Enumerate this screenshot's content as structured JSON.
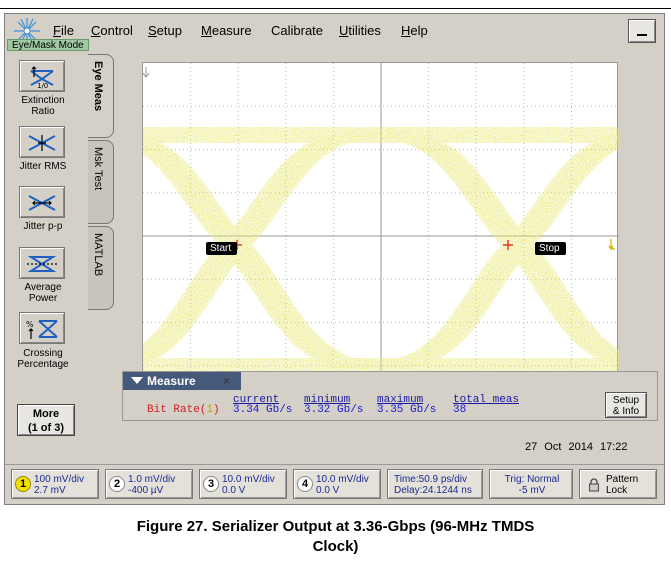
{
  "menu": {
    "items": [
      "File",
      "Control",
      "Setup",
      "Measure",
      "Calibrate",
      "Utilities",
      "Help"
    ],
    "mode_label": "Eye/Mask Mode"
  },
  "left_buttons": [
    {
      "label": "Extinction Ratio"
    },
    {
      "label": "Jitter RMS"
    },
    {
      "label": "Jitter p-p"
    },
    {
      "label": "Average Power"
    },
    {
      "label": "Crossing Percentage"
    }
  ],
  "more_button": {
    "line1": "More",
    "line2": "(1 of 3)"
  },
  "tabs": [
    "Eye Meas",
    "Msk Test",
    "MATLAB"
  ],
  "markers": {
    "start": "Start",
    "stop": "Stop"
  },
  "measure": {
    "tab_label": "Measure",
    "close": "×",
    "headers": [
      "current",
      "minimum",
      "maximum",
      "total meas"
    ],
    "row_name": "Bit Rate(",
    "row_channel": "1",
    "row_name_end": ")",
    "values": [
      "3.34 Gb/s",
      "3.32 Gb/s",
      "3.35 Gb/s",
      "38"
    ],
    "setup_line1": "Setup",
    "setup_line2": "& Info"
  },
  "datetime": {
    "date": "27 Oct 2014",
    "time": "17:22"
  },
  "channels": [
    {
      "num": "1",
      "line1": "100 mV/div",
      "line2": "2.7 mV",
      "on": true
    },
    {
      "num": "2",
      "line1": "1.0 mV/div",
      "line2": "-400 µV",
      "on": false
    },
    {
      "num": "3",
      "line1": "10.0 mV/div",
      "line2": "0.0 V",
      "on": false
    },
    {
      "num": "4",
      "line1": "10.0 mV/div",
      "line2": "0.0 V",
      "on": false
    }
  ],
  "timebase": {
    "line1": "Time:50.9 ps/div",
    "line2": "Delay:24.1244 ns"
  },
  "trigger": {
    "line1": "Trig: Normal",
    "line2": "-5 mV"
  },
  "pattern": {
    "line1": "Pattern",
    "line2": "Lock"
  },
  "caption": {
    "line1": "Figure 27. Serializer Output at 3.36-Gbps (96-MHz TMDS",
    "line2": "Clock)"
  },
  "colors": {
    "trace": "#e8e870",
    "trace_dark": "#c8c840",
    "marker": "#e02020",
    "panel": "#d4d0c8"
  }
}
